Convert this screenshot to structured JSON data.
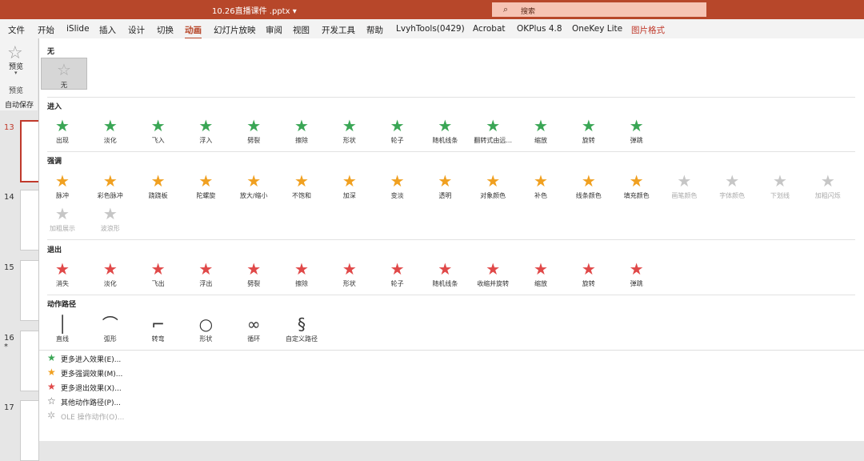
{
  "window": {
    "title": "10.26直播课件 .pptx",
    "title_arrow": "▾"
  },
  "search": {
    "placeholder": "搜索"
  },
  "menus": [
    "文件",
    "开始",
    "iSlide",
    "插入",
    "设计",
    "切换",
    "动画",
    "幻灯片放映",
    "审阅",
    "视图",
    "开发工具",
    "帮助",
    "LvyhTools(0429)",
    "Acrobat",
    "OKPlus 4.8",
    "OneKey Lite",
    "图片格式"
  ],
  "active_menu": "动画",
  "ribbon": {
    "preview_label": "预览",
    "group_label": "预览"
  },
  "autosave": "自动保存",
  "slides": [
    "13",
    "14",
    "15",
    "16",
    "17"
  ],
  "slide16_marker": "*",
  "none_section": {
    "title": "无",
    "item": "无"
  },
  "entrance": {
    "title": "进入",
    "color": "#3aa655",
    "items": [
      "出现",
      "淡化",
      "飞入",
      "浮入",
      "劈裂",
      "擦除",
      "形状",
      "轮子",
      "随机线条",
      "翻转式由远...",
      "缩放",
      "旋转",
      "弹跳"
    ]
  },
  "emphasis": {
    "title": "强调",
    "color": "#f0a020",
    "row1": [
      "脉冲",
      "彩色脉冲",
      "跷跷板",
      "陀螺旋",
      "放大/缩小",
      "不饱和",
      "加深",
      "变淡",
      "透明",
      "对象颜色",
      "补色",
      "线条颜色",
      "填充颜色",
      "画笔颜色",
      "字体颜色",
      "下划线",
      "加粗闪烁"
    ],
    "row1_disabled": [
      false,
      false,
      false,
      false,
      false,
      false,
      false,
      false,
      false,
      false,
      false,
      false,
      false,
      true,
      true,
      true,
      true
    ],
    "row2": [
      "加粗展示",
      "波浪形"
    ]
  },
  "exit": {
    "title": "退出",
    "color": "#e04848",
    "items": [
      "消失",
      "淡化",
      "飞出",
      "浮出",
      "劈裂",
      "擦除",
      "形状",
      "轮子",
      "随机线条",
      "收缩并旋转",
      "缩放",
      "旋转",
      "弹跳"
    ]
  },
  "motion": {
    "title": "动作路径",
    "items": [
      "直线",
      "弧形",
      "转弯",
      "形状",
      "循环",
      "自定义路径"
    ]
  },
  "more": [
    {
      "label": "更多进入效果(E)...",
      "icon": "green-star-icon",
      "color": "#3aa655",
      "disabled": false
    },
    {
      "label": "更多强调效果(M)...",
      "icon": "gold-star-icon",
      "color": "#f0a020",
      "disabled": false
    },
    {
      "label": "更多退出效果(X)...",
      "icon": "red-star-icon",
      "color": "#e04848",
      "disabled": false
    },
    {
      "label": "其他动作路径(P)...",
      "icon": "outline-star-icon",
      "color": "#555555",
      "disabled": false
    },
    {
      "label": "OLE 操作动作(O)...",
      "icon": "gear-star-icon",
      "color": "#bbbbbb",
      "disabled": true
    }
  ]
}
